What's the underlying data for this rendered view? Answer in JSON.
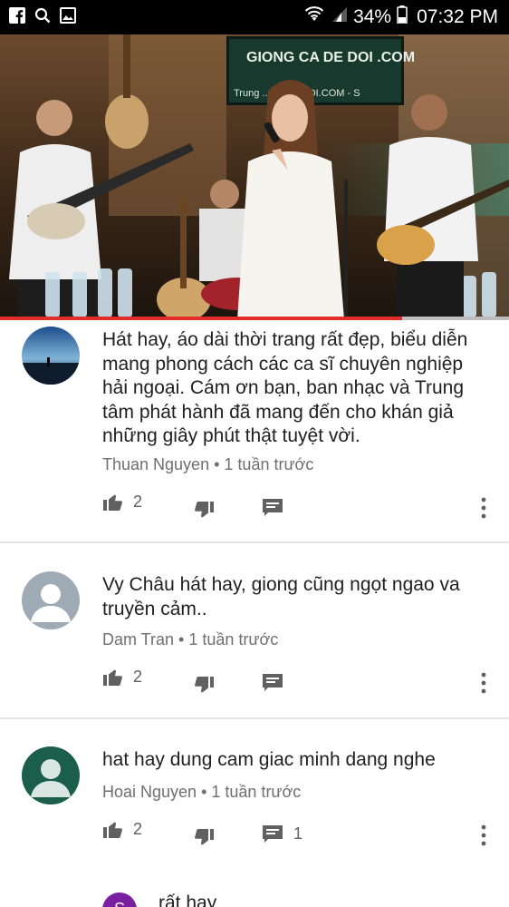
{
  "status_bar": {
    "battery_text": "34%",
    "time": "07:32 PM",
    "left_icons": [
      "facebook-icon",
      "search-icon",
      "image-icon"
    ],
    "right_icons": [
      "wifi-icon",
      "signal-icon",
      "battery-icon"
    ]
  },
  "video": {
    "banner_text": "GIONG CA DE DOI .COM",
    "banner_subtext": "Trung ... CADEDOI.COM - S",
    "progress_fraction": 0.79
  },
  "comments": [
    {
      "text": "Hát hay, áo dài thời trang rất đẹp, biểu diễn mang phong cách các ca sĩ chuyên nghiệp hải ngoại. Cám ơn bạn, ban nhạc và Trung tâm phát hành đã mang đến cho khán giả những giây phút thật tuyệt vời.",
      "author": "Thuan Nguyen",
      "time": "1 tuần trước",
      "likes": "2",
      "replies": ""
    },
    {
      "text": "Vy Châu hát hay, giong cũng ngọt ngao va truyền cảm..",
      "author": "Dam Tran",
      "time": "1 tuần trước",
      "likes": "2",
      "replies": ""
    },
    {
      "text": "hat hay dung cam giac minh dang nghe",
      "author": "Hoai Nguyen",
      "time": "1 tuần trước",
      "likes": "2",
      "replies": "1"
    }
  ],
  "reply_preview": {
    "avatar_letter": "S",
    "text": "rất hay"
  },
  "colors": {
    "progress": "#e52d27",
    "avatar_generic": "#9eaab4",
    "avatar_green": "#1b5e4a",
    "reply_avatar": "#7b1fa2"
  }
}
